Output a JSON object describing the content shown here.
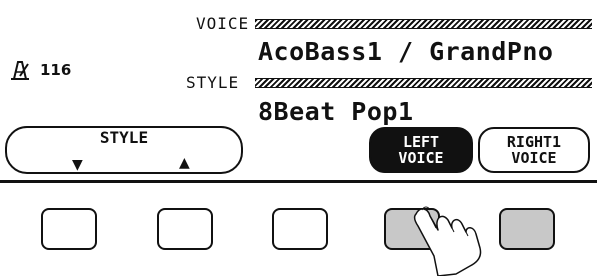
{
  "tempo": {
    "icon": "metronome-icon",
    "value": "116"
  },
  "voice": {
    "label": "VOICE",
    "name": "AcoBass1 / GrandPno"
  },
  "style": {
    "label": "STYLE",
    "name": "8Beat Pop1"
  },
  "soft_buttons": {
    "style_title": "STYLE",
    "down_arrow": "▼",
    "up_arrow": "▲",
    "left_voice": {
      "line1": "LEFT",
      "line2": "VOICE",
      "active": true
    },
    "right1_voice": {
      "line1": "RIGHT1",
      "line2": "VOICE",
      "active": false
    }
  },
  "hardware_buttons": [
    {
      "pressed": false
    },
    {
      "pressed": false
    },
    {
      "pressed": false
    },
    {
      "pressed": true
    },
    {
      "pressed": false,
      "shaded": true
    }
  ]
}
